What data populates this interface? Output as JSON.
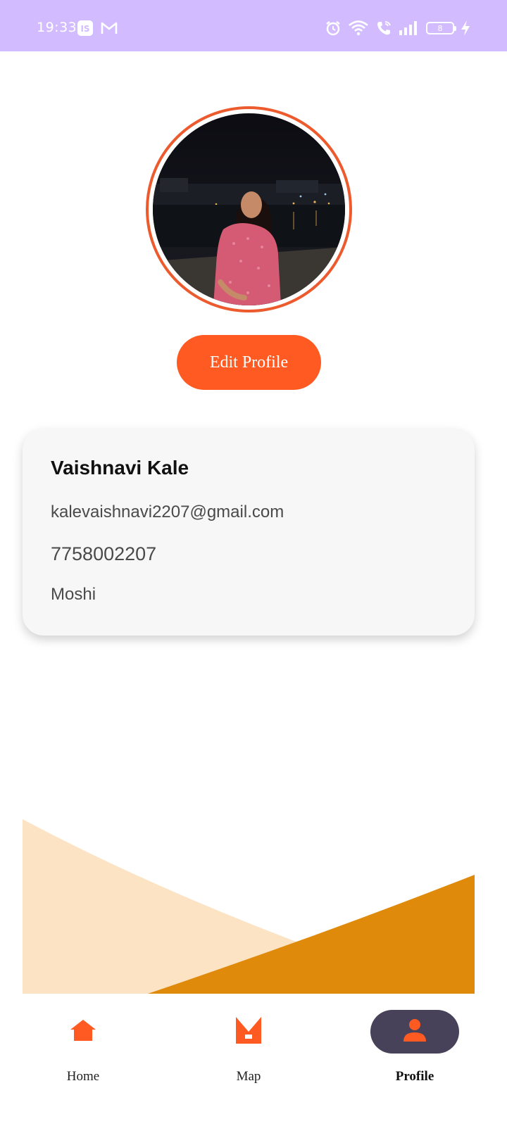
{
  "status_bar": {
    "time": "19:33",
    "battery_level": "8",
    "left_icons": [
      "is-app-icon",
      "gmail-icon"
    ],
    "right_icons": [
      "alarm-icon",
      "wifi-icon",
      "wifi-call-icon",
      "signal-icon",
      "battery-icon",
      "charging-icon"
    ]
  },
  "profile": {
    "edit_button_label": "Edit Profile",
    "name": "Vaishnavi Kale",
    "email": "kalevaishnavi2207@gmail.com",
    "phone": "7758002207",
    "location": "Moshi"
  },
  "bottom_nav": {
    "items": [
      {
        "label": "Home",
        "icon": "home-icon",
        "active": false
      },
      {
        "label": "Map",
        "icon": "map-icon",
        "active": false
      },
      {
        "label": "Profile",
        "icon": "person-icon",
        "active": true
      }
    ]
  },
  "colors": {
    "status_bar": "#d2bcff",
    "accent": "#fe5a22",
    "ring": "#ec5a2d",
    "wave_light": "#fce3c4",
    "wave_dark": "#e08a0c",
    "nav_active_bg": "#47425a"
  }
}
